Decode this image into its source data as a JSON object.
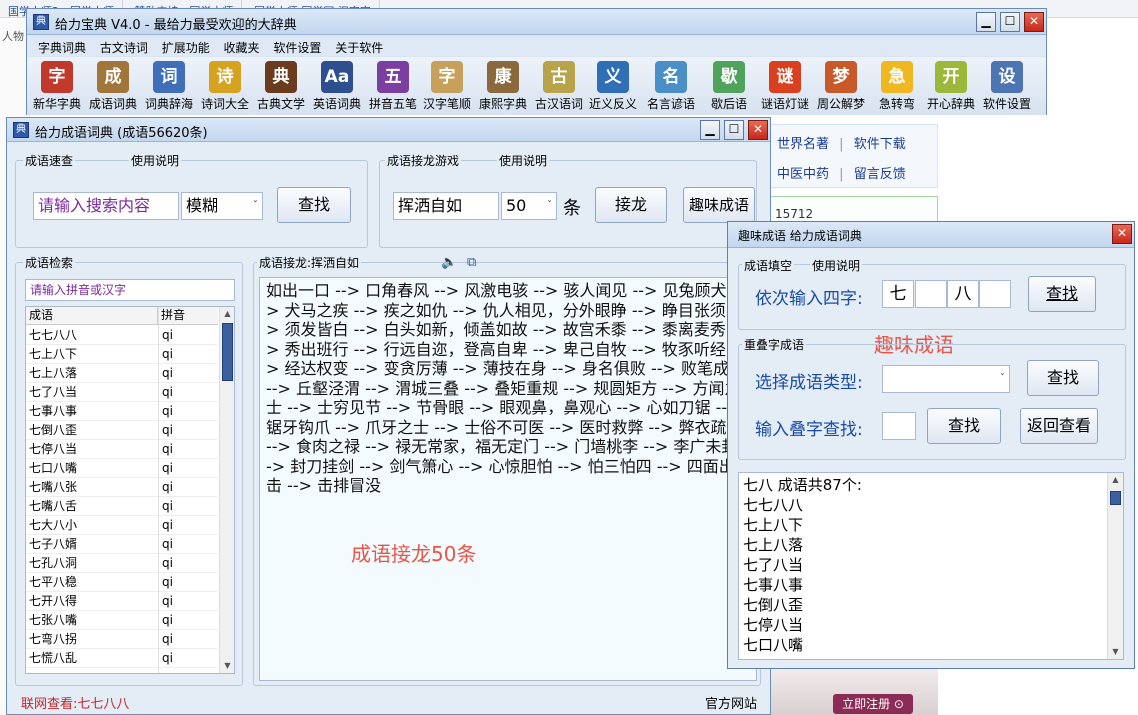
{
  "background": {
    "tabs": [
      "国学大师2 - 国学大师",
      "赞助支持 - 国学大师",
      "国学大师 国学网 汉字字"
    ],
    "left_edge": "人物",
    "links_row1": [
      "世界名著",
      "|",
      "软件下载"
    ],
    "links_row2": [
      "中医中药",
      "|",
      "留言反馈"
    ],
    "count_text": "15712",
    "register_btn": "立即注册 ⊙"
  },
  "main_window": {
    "title": "给力宝典 V4.0  -  最给力最受欢迎的大辞典",
    "menu": [
      "字典词典",
      "古文诗词",
      "扩展功能",
      "收藏夹",
      "软件设置",
      "关于软件"
    ],
    "toolbar": [
      {
        "label": "新华字典",
        "glyph": "字",
        "color": "#c0392b"
      },
      {
        "label": "成语词典",
        "glyph": "成",
        "color": "#a0763a"
      },
      {
        "label": "词典辞海",
        "glyph": "词",
        "color": "#3f6fb8"
      },
      {
        "label": "诗词大全",
        "glyph": "诗",
        "color": "#d6a321"
      },
      {
        "label": "古典文学",
        "glyph": "典",
        "color": "#6b3b1e"
      },
      {
        "label": "英语词典",
        "glyph": "Aa",
        "color": "#2d4f8f"
      },
      {
        "label": "拼音五笔",
        "glyph": "五",
        "color": "#7a3fa0"
      },
      {
        "label": "汉字笔顺",
        "glyph": "字",
        "color": "#c7a15c"
      },
      {
        "label": "康熙字典",
        "glyph": "康",
        "color": "#8a6a3c"
      },
      {
        "label": "古汉语词",
        "glyph": "古",
        "color": "#b8a24a"
      },
      {
        "label": "近义反义",
        "glyph": "义",
        "color": "#2e6fb5"
      },
      {
        "label": "名言谚语",
        "glyph": "名",
        "color": "#4a8fc7"
      },
      {
        "label": "歇后语",
        "glyph": "歇",
        "color": "#4fa35a"
      },
      {
        "label": "谜语灯谜",
        "glyph": "谜",
        "color": "#d9401f"
      },
      {
        "label": "周公解梦",
        "glyph": "梦",
        "color": "#c85a2a"
      },
      {
        "label": "急转弯",
        "glyph": "急",
        "color": "#f0b820"
      },
      {
        "label": "开心辞典",
        "glyph": "开",
        "color": "#9bb83a"
      },
      {
        "label": "软件设置",
        "glyph": "设",
        "color": "#4d74b3"
      }
    ]
  },
  "idiom_window": {
    "title": "给力成语词典  (成语56620条)",
    "quick": {
      "group": "成语速查",
      "help": "使用说明",
      "input_placeholder": "请输入搜索内容",
      "mode": "模糊",
      "search_btn": "查找"
    },
    "game": {
      "group": "成语接龙游戏",
      "help": "使用说明",
      "word": "挥洒自如",
      "count": "50",
      "unit": "条",
      "chain_btn": "接龙",
      "fun_btn": "趣味成语"
    },
    "search_list": {
      "group": "成语检索",
      "placeholder": "请输入拼音或汉字",
      "col_idiom": "成语",
      "col_pinyin": "拼音",
      "rows": [
        [
          "七七八八",
          "qi"
        ],
        [
          "七上八下",
          "qi"
        ],
        [
          "七上八落",
          "qi"
        ],
        [
          "七了八当",
          "qi"
        ],
        [
          "七事八事",
          "qi"
        ],
        [
          "七倒八歪",
          "qi"
        ],
        [
          "七停八当",
          "qi"
        ],
        [
          "七口八嘴",
          "qi"
        ],
        [
          "七嘴八张",
          "qi"
        ],
        [
          "七嘴八舌",
          "qi"
        ],
        [
          "七大八小",
          "qi"
        ],
        [
          "七子八婿",
          "qi"
        ],
        [
          "七孔八洞",
          "qi"
        ],
        [
          "七平八稳",
          "qi"
        ],
        [
          "七开八得",
          "qi"
        ],
        [
          "七张八嘴",
          "qi"
        ],
        [
          "七弯八拐",
          "qi"
        ],
        [
          "七慌八乱",
          "qi"
        ]
      ]
    },
    "chain": {
      "header": "成语接龙:挥洒自如",
      "text": "如出一口 --> 口角春风 --> 风激电骇 --> 骇人闻见 --> 见兔顾犬 --> 犬马之疾 --> 疾之如仇 --> 仇人相见，分外眼睁 --> 睁目张须 --> 须发皆白 --> 白头如新，倾盖如故 --> 故宫禾黍 --> 黍离麦秀 --> 秀出班行 --> 行远自迩，登高自卑 --> 卑己自牧 --> 牧豕听经 --> 经达权变 --> 变贪厉薄 --> 薄技在身 --> 身名俱败 --> 败笔成丘 --> 丘壑泾渭 --> 渭城三叠 --> 叠矩重规 --> 规圆矩方 --> 方闻之士 --> 士穷见节 --> 节骨眼 --> 眼观鼻，鼻观心 --> 心如刀锯 --> 锯牙钩爪 --> 爪牙之士 --> 士俗不可医 --> 医时救弊 --> 弊衣疏食 --> 食肉之禄 --> 禄无常家，福无定门 --> 门墙桃李 --> 李广未封 --> 封刀挂剑 --> 剑气箫心 --> 心惊胆怕 --> 怕三怕四 --> 四面出击 --> 击排冒没",
      "caption": "成语接龙50条"
    },
    "status_left": "联网查看:七七八八",
    "status_right": "官方网站"
  },
  "fun_window": {
    "title": "趣味成语   给力成语词典",
    "fill": {
      "group": "成语填空",
      "help": "使用说明",
      "label": "依次输入四字:",
      "cells": [
        "七",
        "",
        "八",
        ""
      ],
      "btn": "查找"
    },
    "caption": "趣味成语",
    "repeat": {
      "group": "重叠字成语",
      "type_label": "选择成语类型:",
      "type_value": "",
      "type_btn": "查找",
      "char_label": "输入叠字查找:",
      "char_value": "",
      "char_btn": "查找",
      "back_btn": "返回查看"
    },
    "results": {
      "header": "七八 成语共87个:",
      "items": [
        "七七八八",
        "七上八下",
        "七上八落",
        "七了八当",
        "七事八事",
        "七倒八歪",
        "七停八当",
        "七口八嘴"
      ]
    }
  }
}
